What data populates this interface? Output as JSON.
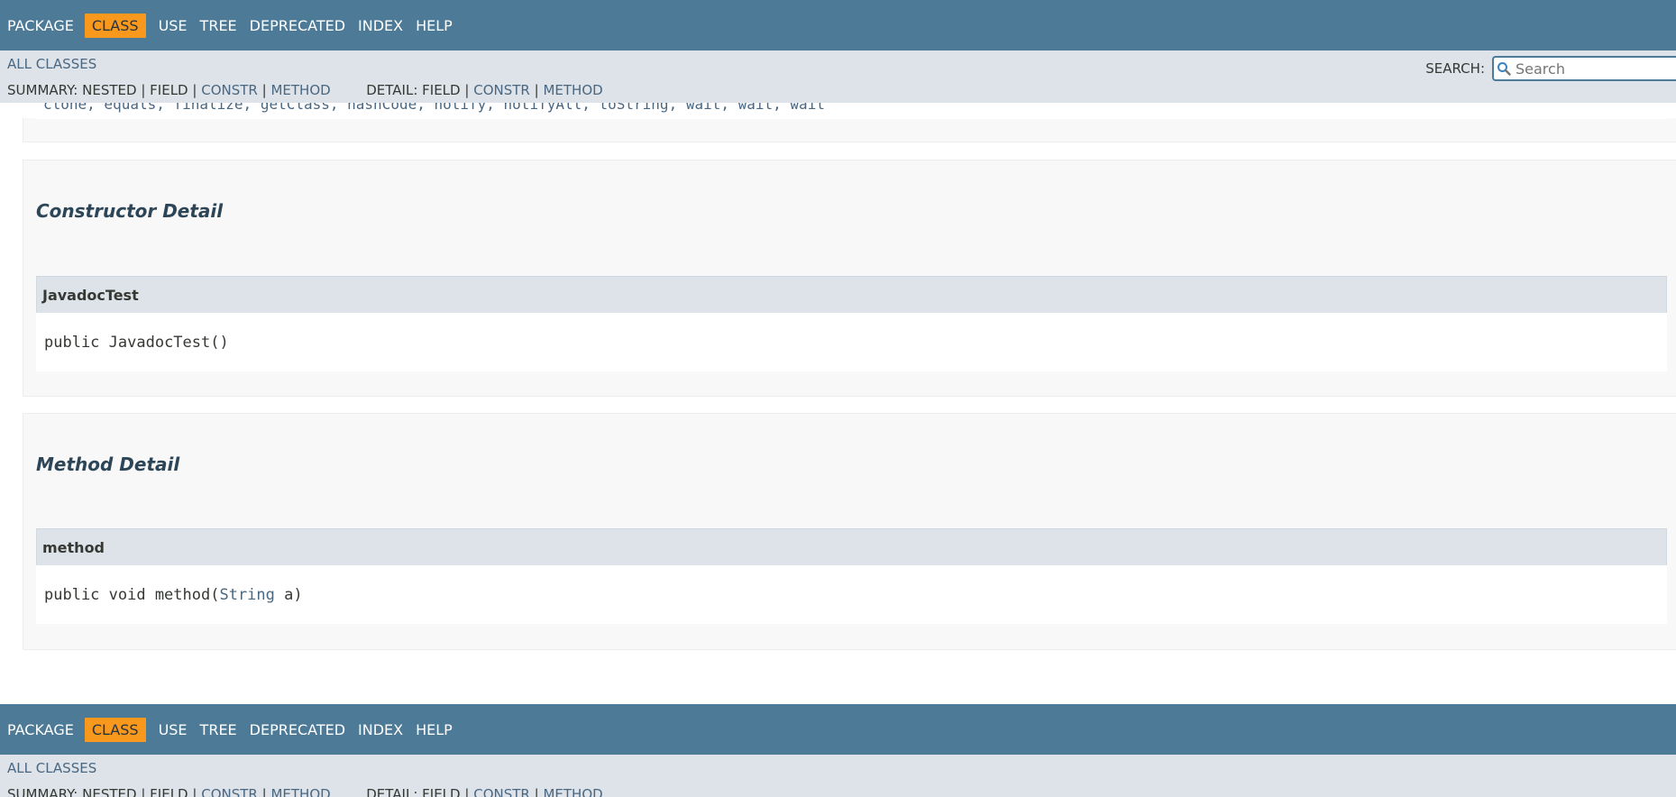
{
  "top_nav": {
    "items": [
      {
        "label": "PACKAGE",
        "active": false
      },
      {
        "label": "CLASS",
        "active": true
      },
      {
        "label": "USE",
        "active": false
      },
      {
        "label": "TREE",
        "active": false
      },
      {
        "label": "DEPRECATED",
        "active": false
      },
      {
        "label": "INDEX",
        "active": false
      },
      {
        "label": "HELP",
        "active": false
      }
    ]
  },
  "sub_nav": {
    "all_classes": "ALL CLASSES",
    "summary_label": "SUMMARY:",
    "summary_nested": "NESTED",
    "summary_field": "FIELD",
    "summary_constr": "CONSTR",
    "summary_method": "METHOD",
    "detail_label": "DETAIL:",
    "detail_field": "FIELD",
    "detail_constr": "CONSTR",
    "detail_method": "METHOD",
    "separator": "|"
  },
  "search": {
    "label": "SEARCH:",
    "placeholder": "Search",
    "value": ""
  },
  "inherited_methods": "clone, equals, finalize, getClass, hashCode, notify, notifyAll, toString, wait, wait, wait",
  "constructor_detail": {
    "title": "Constructor Detail",
    "member_name": "JavadocTest",
    "signature_prefix": "public ",
    "signature_name": "JavadocTest()"
  },
  "method_detail": {
    "title": "Method Detail",
    "member_name": "method",
    "signature_prefix": "public void method(",
    "param_type": "String",
    "signature_suffix": " a)"
  },
  "colors": {
    "nav_bg": "#4d7a97",
    "nav_active": "#f8981d",
    "subnav_bg": "#dee3e9",
    "link": "#4a6782"
  }
}
